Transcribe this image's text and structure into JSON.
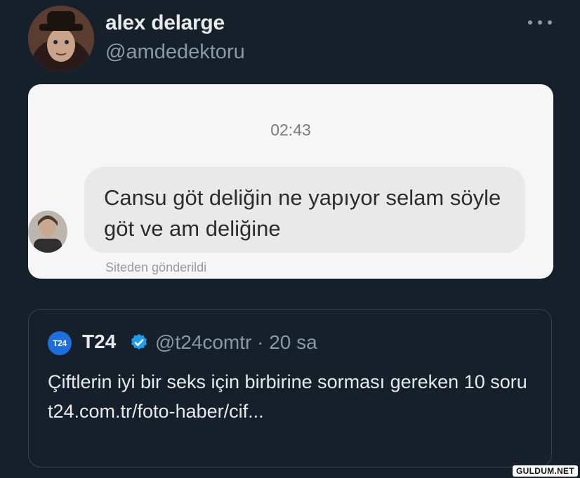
{
  "tweet": {
    "author_name": "alex delarge",
    "author_handle": "@amdedektoru",
    "avatar_icon": "profile-photo",
    "more_icon": "more-horizontal-icon"
  },
  "media": {
    "timestamp": "02:43",
    "message": "Cansu göt deliğin ne yapıyor selam söyle göt ve am deliğine",
    "sent_from": "Siteden gönderildi"
  },
  "quoted_tweet": {
    "logo_text": "T24",
    "name": "T24",
    "verified_icon": "verified-badge-icon",
    "handle_time": "@t24comtr · 20 sa",
    "text": "Çiftlerin iyi bir seks için birbirine sorması gereken 10 soru t24.com.tr/foto-haber/cif..."
  },
  "watermark": "GULDUM.NET",
  "colors": {
    "background": "#15202b",
    "primary_text": "#e7e9ea",
    "secondary_text": "#8b98a5",
    "verified_blue": "#1d9bf0",
    "border": "#38444d"
  }
}
